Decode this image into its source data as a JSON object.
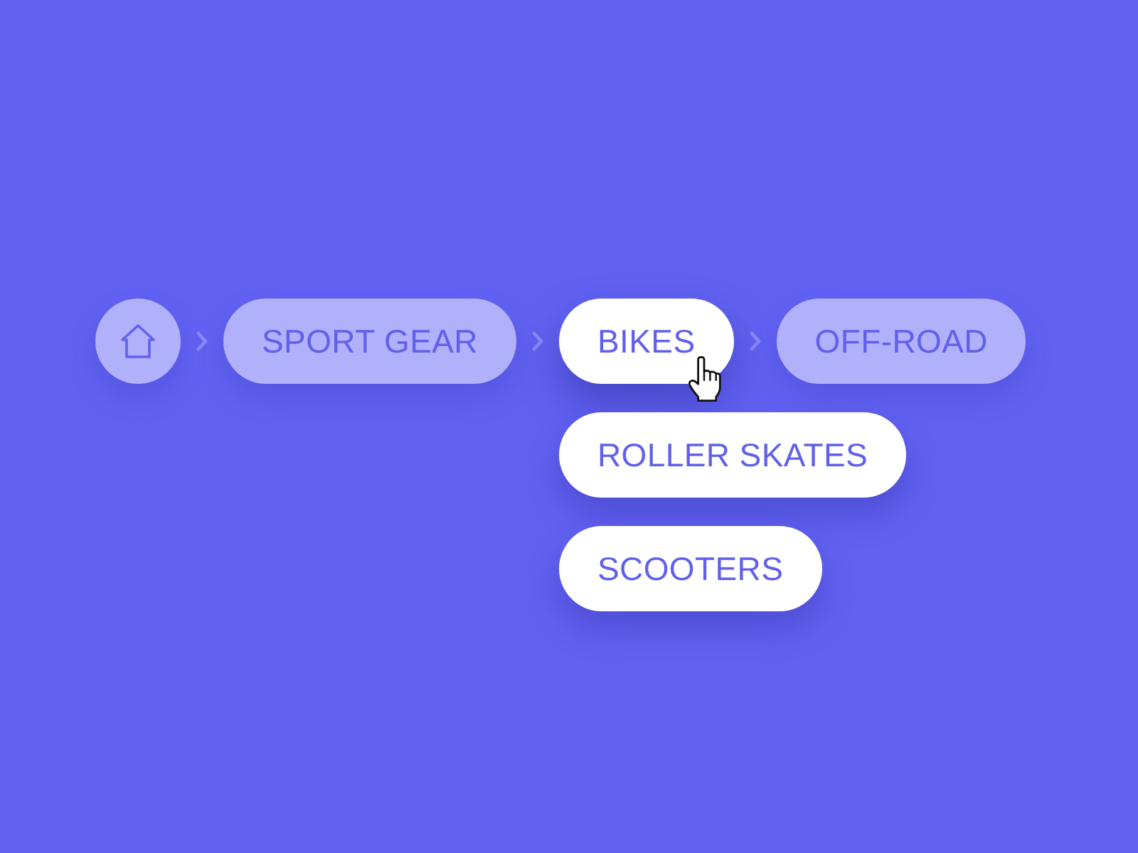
{
  "breadcrumb": {
    "items": [
      {
        "kind": "home",
        "selected": false,
        "hovered": false
      },
      {
        "kind": "link",
        "label": "SPORT GEAR",
        "selected": false,
        "hovered": false
      },
      {
        "kind": "link",
        "label": "BIKES",
        "selected": true,
        "hovered": true,
        "menu": [
          {
            "label": "ROLLER SKATES"
          },
          {
            "label": "SCOOTERS"
          }
        ]
      },
      {
        "kind": "link",
        "label": "OFF-ROAD",
        "selected": false,
        "hovered": false
      }
    ]
  }
}
